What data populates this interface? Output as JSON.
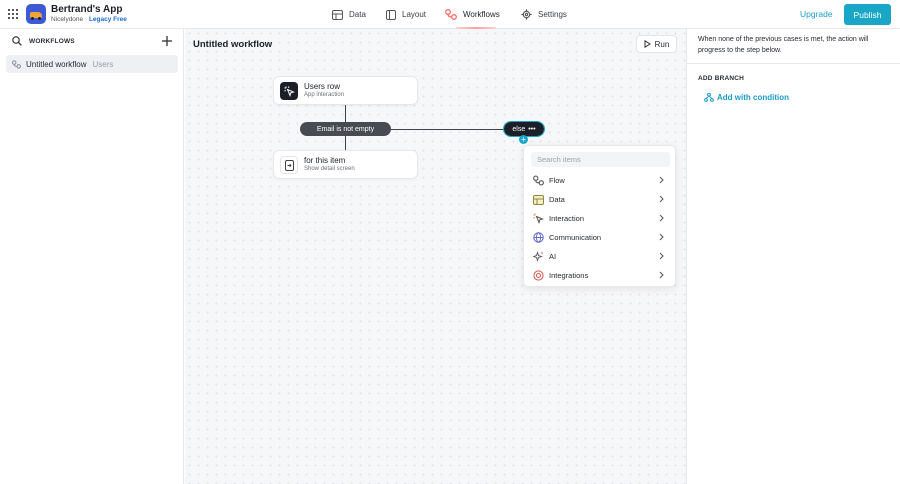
{
  "app": {
    "name": "Bertrand's App",
    "org": "Nicelydone",
    "separator": " · ",
    "plan": "Legacy Free"
  },
  "nav": [
    {
      "label": "Data",
      "icon": "table-icon"
    },
    {
      "label": "Layout",
      "icon": "layout-icon"
    },
    {
      "label": "Workflows",
      "icon": "workflows-icon",
      "active": true
    },
    {
      "label": "Settings",
      "icon": "gear-icon"
    }
  ],
  "header_actions": {
    "upgrade": "Upgrade",
    "publish": "Publish"
  },
  "colors": {
    "accent": "#1aa7c7",
    "active_nav": "#ff6b6b",
    "plan": "#1a6bcf"
  },
  "sidebar": {
    "heading": "WORKFLOWS",
    "items": [
      {
        "label": "Untitled workflow",
        "tag": "Users"
      }
    ]
  },
  "canvas": {
    "title": "Untitled workflow",
    "run_label": "Run",
    "trigger": {
      "title": "Users row",
      "subtitle": "App interaction"
    },
    "condition": "Email is not empty",
    "else_label": "else",
    "action": {
      "title": "for this item",
      "subtitle": "Show detail screen"
    }
  },
  "add_menu": {
    "search_placeholder": "Search items",
    "items": [
      {
        "label": "Flow",
        "icon": "flow-icon"
      },
      {
        "label": "Data",
        "icon": "data-icon"
      },
      {
        "label": "Interaction",
        "icon": "interaction-icon"
      },
      {
        "label": "Communication",
        "icon": "globe-icon"
      },
      {
        "label": "AI",
        "icon": "sparkle-icon"
      },
      {
        "label": "Integrations",
        "icon": "integrations-icon"
      }
    ]
  },
  "right_panel": {
    "description": "When none of the previous cases is met, the action will progress to the step below.",
    "add_branch_label": "ADD BRANCH",
    "add_condition": "Add with condition"
  }
}
